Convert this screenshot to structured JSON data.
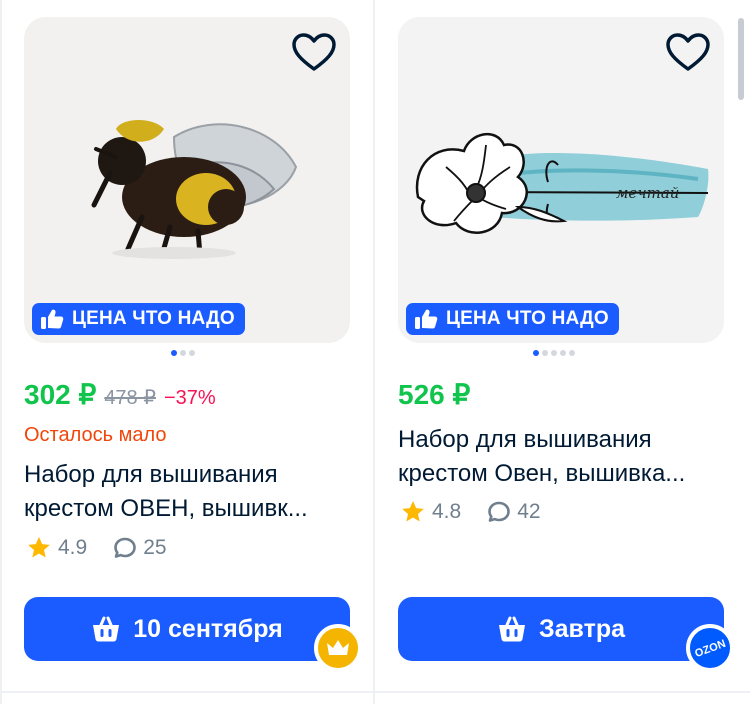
{
  "products": [
    {
      "price": "302 ₽",
      "old_price": "478 ₽",
      "discount": "−37%",
      "stock_note": "Осталось мало",
      "title_line1": "Набор для вышивания",
      "title_line2": "крестом ОВЕН, вышивк...",
      "rating": "4.9",
      "reviews": "25",
      "promo_label": "ЦЕНА ЧТО НАДО",
      "delivery_label": "10 сентября",
      "image_subject": "embroidered bumblebee",
      "photo_dots": 3,
      "active_dot": 1,
      "badge": "crown-badge-icon",
      "badge_color": "#f4b400"
    },
    {
      "price": "526 ₽",
      "title_line1": "Набор для вышивания",
      "title_line2": "крестом Овен, вышивка...",
      "rating": "4.8",
      "reviews": "42",
      "promo_label": "ЦЕНА ЧТО НАДО",
      "delivery_label": "Завтра",
      "image_subject": "embroidered flower with blue stroke and lettering",
      "image_script_text": "мечтай",
      "photo_dots": 5,
      "active_dot": 1,
      "badge": "ozon-badge",
      "badge_text": "OZON",
      "badge_color": "#005bff"
    }
  ],
  "colors": {
    "accent": "#1a5cff",
    "price_green": "#10c44c",
    "discount_red": "#f91155",
    "stock_orange": "#f1460b",
    "star": "#ffb800",
    "text_dark": "#001a34",
    "text_muted": "#707f8d"
  }
}
